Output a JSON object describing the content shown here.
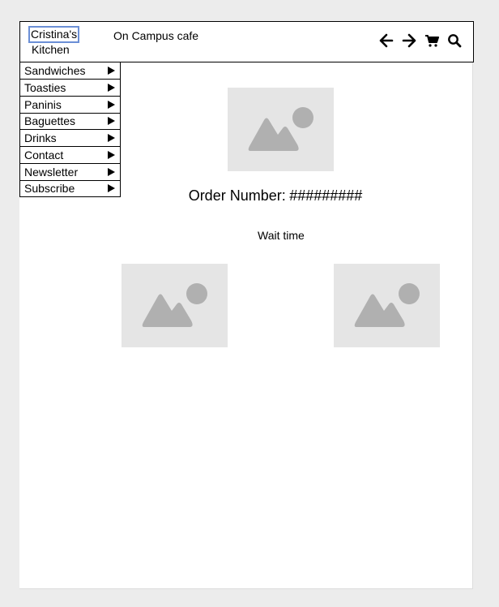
{
  "header": {
    "logo_line1": "Cristina's",
    "logo_line2": "Kitchen",
    "tagline": "On Campus cafe",
    "icons": [
      "arrow-left-icon",
      "arrow-right-icon",
      "cart-icon",
      "search-icon"
    ]
  },
  "menu": {
    "items": [
      {
        "label": "Sandwiches"
      },
      {
        "label": "Toasties"
      },
      {
        "label": "Paninis"
      },
      {
        "label": "Baguettes"
      },
      {
        "label": "Drinks"
      },
      {
        "label": "Contact"
      },
      {
        "label": "Newsletter"
      },
      {
        "label": "Subscribe"
      }
    ]
  },
  "main": {
    "order_label": "Order Number:",
    "order_value": "#########",
    "wait_label": "Wait time"
  }
}
